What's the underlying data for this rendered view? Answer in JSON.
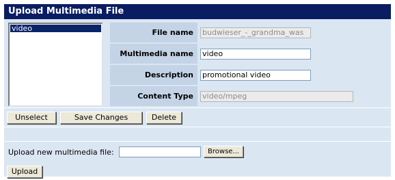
{
  "title": "Upload Multimedia File",
  "list": {
    "items": [
      "video"
    ],
    "selected": "video"
  },
  "fields": [
    {
      "label": "File name",
      "value": "budwieser_-_grandma_was",
      "disabled": true
    },
    {
      "label": "Multimedia name",
      "value": "video",
      "disabled": false
    },
    {
      "label": "Description",
      "value": "promotional video",
      "disabled": false
    },
    {
      "label": "Content Type",
      "value": "video/mpeg",
      "disabled": true
    }
  ],
  "buttons": {
    "unselect": "Unselect",
    "save": "Save Changes",
    "delete": "Delete"
  },
  "upload": {
    "label": "Upload new multimedia file:",
    "file_value": "",
    "browse": "Browse...",
    "submit": "Upload"
  }
}
